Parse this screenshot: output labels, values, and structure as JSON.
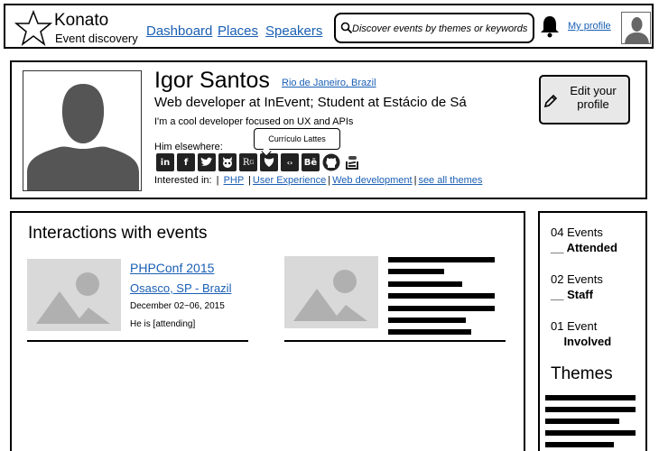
{
  "brand": {
    "name": "Konato",
    "tagline": "Event discovery"
  },
  "nav": [
    {
      "label": "Dashboard"
    },
    {
      "label": "Places"
    },
    {
      "label": "Speakers"
    }
  ],
  "search": {
    "placeholder": "Discover events by themes or keywords"
  },
  "header": {
    "my_profile": "My profile"
  },
  "profile": {
    "name": "Igor Santos",
    "location": "Rio de Janeiro, Brazil",
    "job": "Web developer at InEvent; Student at Estácio de Sá",
    "bio": "I'm a cool developer focused on UX and APIs",
    "elsewhere_label": "Him elsewhere:",
    "social_icons": [
      "linkedin-icon",
      "facebook-icon",
      "twitter-icon",
      "github-alt-icon",
      "researchgate-icon",
      "lattes-icon",
      "codepen-icon",
      "behance-icon",
      "github-icon",
      "stackoverflow-icon"
    ],
    "tooltip": "Currículo Lattes",
    "interested_label": "Interested in:",
    "interests": [
      "PHP",
      "User Experience",
      "Web development"
    ],
    "see_all": "see all themes",
    "edit_button": "Edit your profile"
  },
  "interactions": {
    "title": "Interactions with events",
    "event1": {
      "title": "PHPConf 2015",
      "location": "Osasco, SP - Brazil",
      "date": "December 02~06, 2015",
      "status": "He is [attending]"
    }
  },
  "stats": {
    "items": [
      {
        "number": "04 Events",
        "label": "__ Attended"
      },
      {
        "number": "02 Events",
        "label": "__ Staff"
      },
      {
        "number": "01 Event",
        "label": "    Involved"
      }
    ],
    "themes_title": "Themes"
  }
}
